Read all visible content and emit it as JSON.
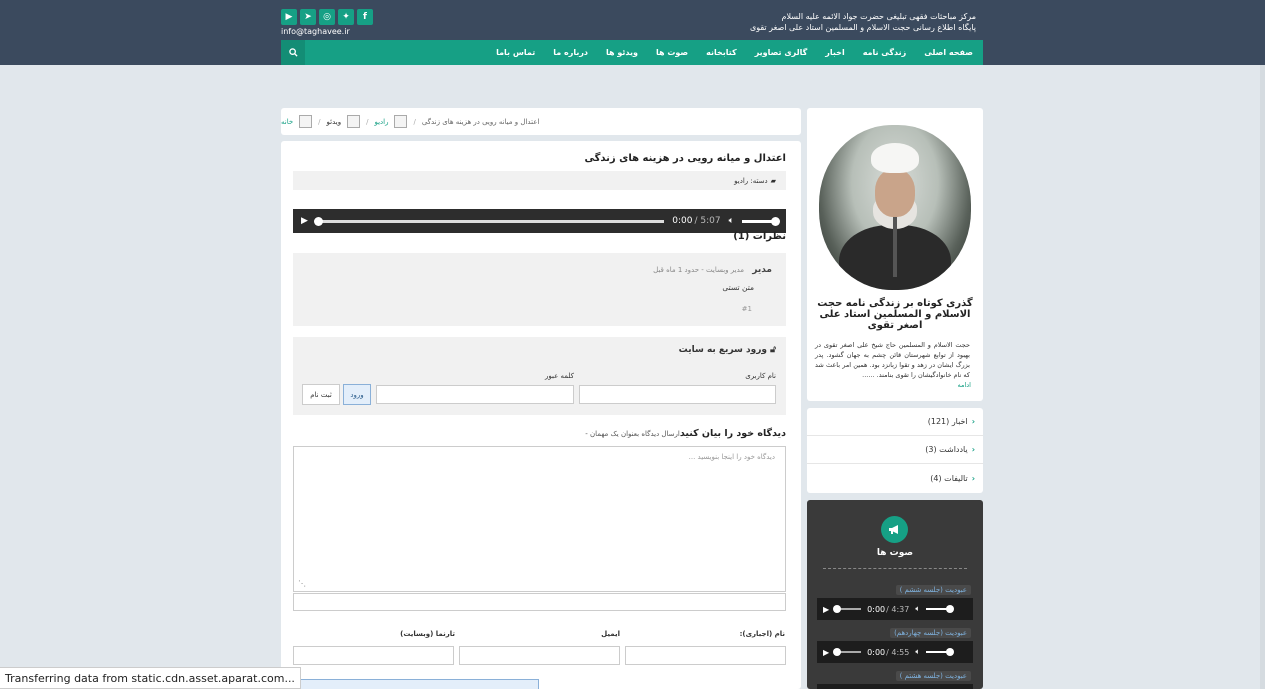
{
  "header": {
    "title_line1": "مرکز مباحثات فقهی تبلیغی حضرت جواد الائمه علیه السلام",
    "title_line2": "پایگاه اطلاع رسانی حجت الاسلام و المسلمین استاد علی اصغر تقوی",
    "email": "info@taghavee.ir",
    "socials": [
      {
        "name": "youtube",
        "glyph": "▶"
      },
      {
        "name": "telegram",
        "glyph": "➤"
      },
      {
        "name": "instagram",
        "glyph": "◎"
      },
      {
        "name": "twitter",
        "glyph": "✦"
      },
      {
        "name": "facebook",
        "glyph": "f"
      }
    ]
  },
  "nav": {
    "items": [
      "صفحه اصلی",
      "زندگی نامه",
      "اخبار",
      "گالری تصاویر",
      "کتابخانه",
      "صوت ها",
      "ویدئو ها",
      "درباره ما",
      "تماس باما"
    ],
    "search_icon": "search-icon"
  },
  "breadcrumb": {
    "home": "خانه",
    "video": "ویدئو",
    "radio": "رادیو",
    "current": "اعتدال و میانه رویی در هزینه های زندگی"
  },
  "post": {
    "title": "اعتدال و میانه رویی در هزینه های زندگی",
    "category": "دسته: رادیو",
    "player": {
      "current": "0:00",
      "duration": "/ 5:07"
    }
  },
  "comments": {
    "heading": "نظرات (1)",
    "items": [
      {
        "author": "مدیر",
        "meta": "مدیر وبسایت - حدود 1 ماه قبل",
        "text": "متن تستی",
        "num": "#1"
      }
    ]
  },
  "login": {
    "title": "ورود سریع به سایت",
    "username_label": "نام کاربری",
    "password_label": "کلمه عبور",
    "login_button": "ورود",
    "register_button": "ثبت نام"
  },
  "opinion": {
    "heading": "دیدگاه خود را بیان کنید",
    "sub": "ارسال دیدگاه بعنوان یک مهمان -",
    "placeholder": "دیدگاه خود را اینجا بنویسید ...",
    "name_label": "نام (اجباری):",
    "email_label": "ایمیل",
    "website_label": "تارنما (وبسایت)"
  },
  "sidebar": {
    "profile_title": "گذری کوتاه بر زندگی نامه حجت الاسلام و المسلمین استاد علی اصغر تقوی",
    "profile_text": "حجت الاسلام و المسلمین حاج شیخ علی اصغر تقوی در بهبود از توابع شهرستان قائن چشم به جهان گشود. پدر بزرگ ایشان در زهد و تقوا زبانزد بود. همین امر باعث شد که نام خانوادگیشان را تقوی بنامند. ......",
    "more": "ادامه",
    "categories": [
      {
        "label": "اخبار (121)"
      },
      {
        "label": "یادداشت (3)"
      },
      {
        "label": "تالیفات (4)"
      }
    ],
    "audio_title": "صوت ها",
    "tracks": [
      {
        "title": "عبودیت (جلسه ششم )",
        "current": "0:00",
        "duration": "/ 4:37"
      },
      {
        "title": "عبودیت (جلسه چهاردهم)",
        "current": "0:00",
        "duration": "/ 4:55"
      },
      {
        "title": "عبودیت (جلسه هشتم )"
      }
    ]
  },
  "status": "Transferring data from static.cdn.asset.aparat.com...",
  "colors": {
    "accent": "#16a085",
    "header_bg": "#3b4a5e",
    "page_bg": "#e1e7ec"
  }
}
